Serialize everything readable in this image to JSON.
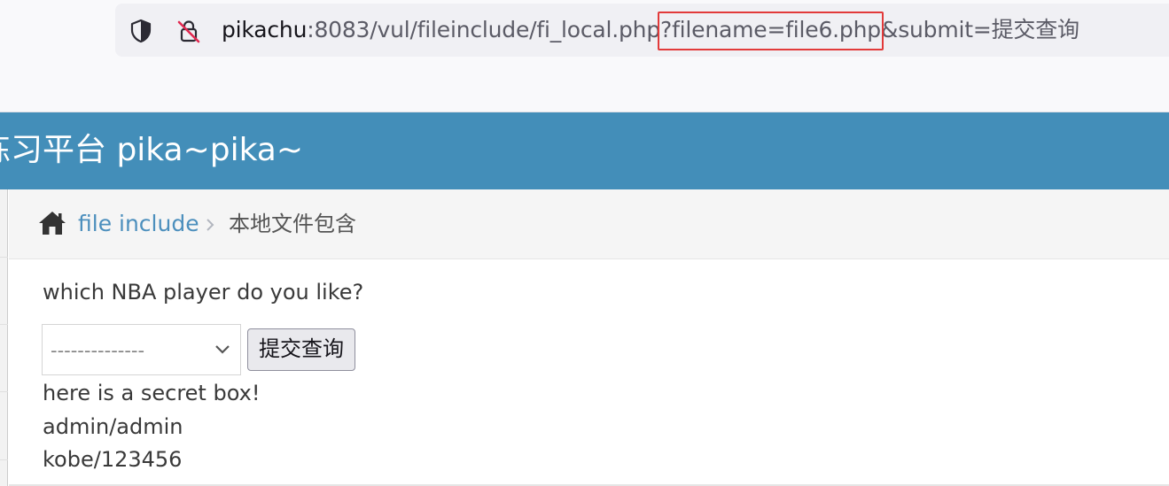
{
  "browser": {
    "url_host": "pikachu",
    "url_path": ":8083/vul/fileinclude/fi_local.php",
    "url_query_highlighted": "?filename=file6.php",
    "url_query_rest": "&submit=提交查询",
    "icons": [
      "shield-icon",
      "lock-slash-icon"
    ],
    "highlight_color": "#e23a3a"
  },
  "header": {
    "title": "练习平台 pika~pika~",
    "background": "#438eb9"
  },
  "breadcrumb": {
    "link": "file include",
    "current": "本地文件包含",
    "icons": [
      "home-icon",
      "chevron-right-icon"
    ]
  },
  "form": {
    "question": "which NBA player do you like?",
    "select_value": "--------------",
    "submit_label": "提交查询"
  },
  "result": {
    "lines": [
      "here is a secret box!",
      "admin/admin",
      "kobe/123456"
    ]
  }
}
